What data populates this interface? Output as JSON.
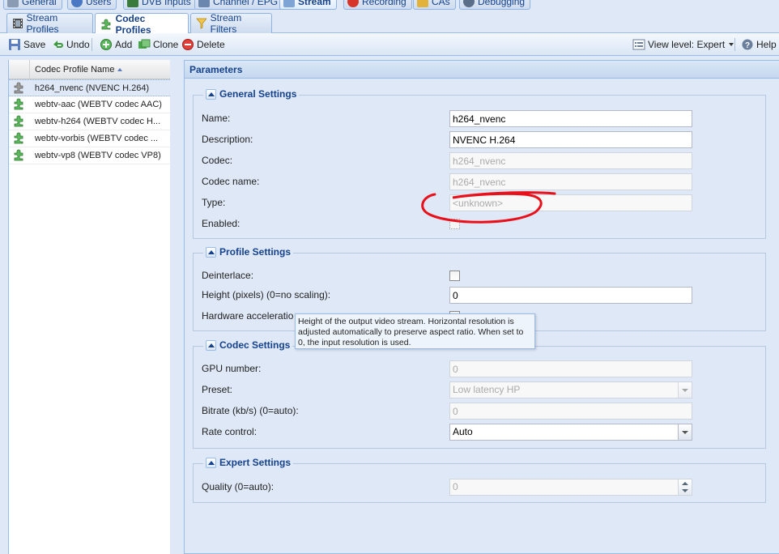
{
  "top_tabs": [
    {
      "label": "General",
      "active": false
    },
    {
      "label": "Users",
      "active": false
    },
    {
      "label": "DVB Inputs",
      "active": false
    },
    {
      "label": "Channel / EPG",
      "active": false
    },
    {
      "label": "Stream",
      "active": true
    },
    {
      "label": "Recording",
      "active": false
    },
    {
      "label": "CAs",
      "active": false
    },
    {
      "label": "Debugging",
      "active": false
    }
  ],
  "sub_tabs": [
    {
      "label": "Stream Profiles",
      "active": false
    },
    {
      "label": "Codec Profiles",
      "active": true
    },
    {
      "label": "Stream Filters",
      "active": false
    }
  ],
  "toolbar": {
    "save_label": "Save",
    "undo_label": "Undo",
    "add_label": "Add",
    "clone_label": "Clone",
    "delete_label": "Delete",
    "view_level_label": "View level: Expert",
    "help_label": "Help"
  },
  "grid": {
    "column_header": "Codec Profile Name",
    "rows": [
      {
        "label": "h264_nvenc (NVENC H.264)",
        "selected": true
      },
      {
        "label": "webtv-aac (WEBTV codec AAC)",
        "selected": false
      },
      {
        "label": "webtv-h264 (WEBTV codec H...",
        "selected": false
      },
      {
        "label": "webtv-vorbis (WEBTV codec ...",
        "selected": false
      },
      {
        "label": "webtv-vp8 (WEBTV codec VP8)",
        "selected": false
      }
    ]
  },
  "parameters": {
    "title": "Parameters",
    "general": {
      "legend": "General Settings",
      "name_label": "Name:",
      "name_value": "h264_nvenc",
      "description_label": "Description:",
      "description_value": "NVENC H.264",
      "codec_label": "Codec:",
      "codec_value": "h264_nvenc",
      "codec_name_label": "Codec name:",
      "codec_name_value": "h264_nvenc",
      "type_label": "Type:",
      "type_value": "<unknown>",
      "enabled_label": "Enabled:"
    },
    "profile": {
      "legend": "Profile Settings",
      "deinterlace_label": "Deinterlace:",
      "height_label": "Height (pixels) (0=no scaling):",
      "height_value": "0",
      "hwaccel_label": "Hardware acceleratio"
    },
    "codec": {
      "legend": "Codec Settings",
      "gpu_label": "GPU number:",
      "gpu_value": "0",
      "preset_label": "Preset:",
      "preset_value": "Low latency HP",
      "bitrate_label": "Bitrate (kb/s) (0=auto):",
      "bitrate_value": "0",
      "rate_control_label": "Rate control:",
      "rate_control_value": "Auto"
    },
    "expert": {
      "legend": "Expert Settings",
      "quality_label": "Quality (0=auto):",
      "quality_value": "0"
    }
  },
  "tooltip": {
    "text": "Height of the output video stream. Horizontal resolution is adjusted automatically to preserve aspect ratio. When set to 0, the input resolution is used."
  },
  "colors": {
    "accent": "#15428b",
    "annotation": "#e8101a"
  }
}
